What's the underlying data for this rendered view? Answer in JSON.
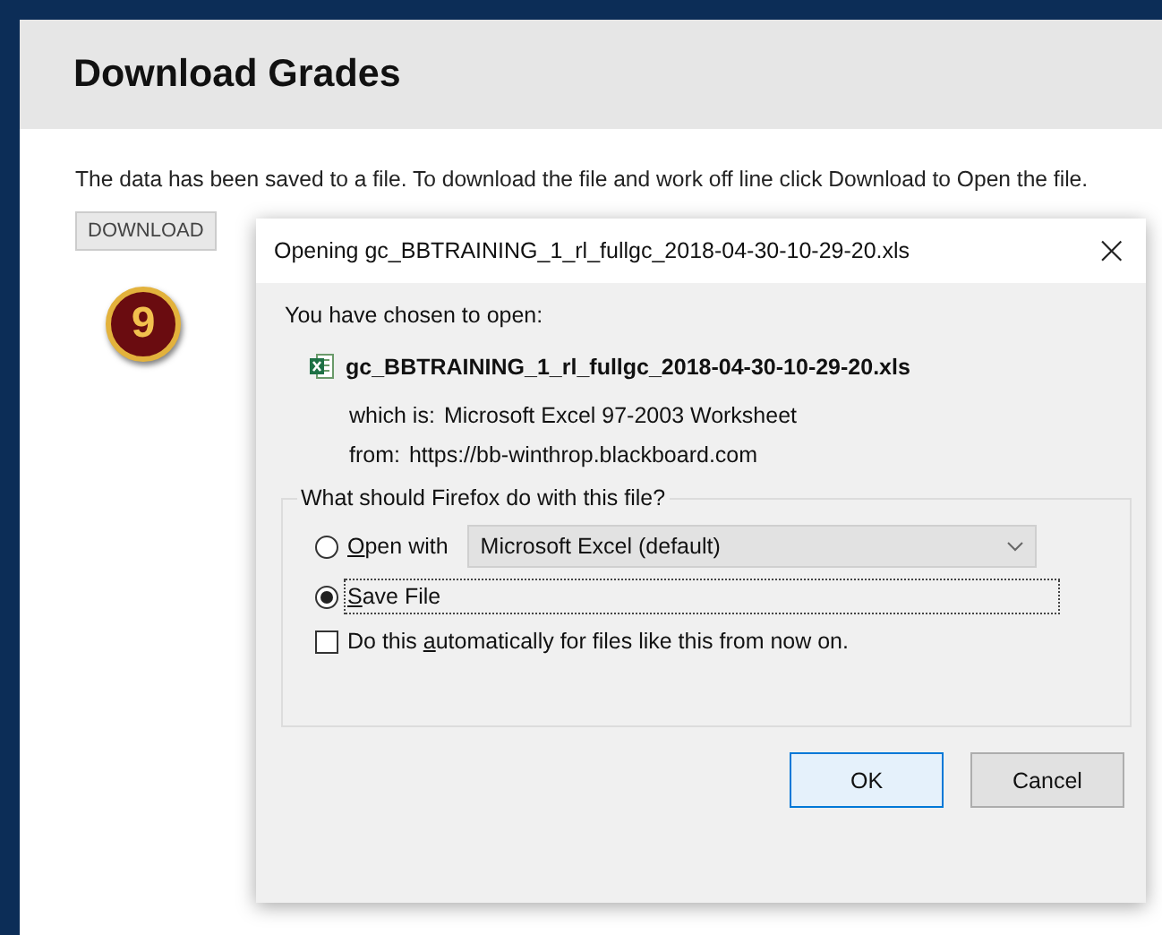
{
  "page": {
    "title": "Download Grades",
    "message": "The data has been saved to a file. To download the file and work off line click Download to Open the file.",
    "download_button": "DOWNLOAD",
    "step_badge": "9"
  },
  "dialog": {
    "title": "Opening gc_BBTRAINING_1_rl_fullgc_2018-04-30-10-29-20.xls",
    "close": "×",
    "intro": "You have chosen to open:",
    "file_name": "gc_BBTRAINING_1_rl_fullgc_2018-04-30-10-29-20.xls",
    "which_is_label": "which is:",
    "which_is_value": "Microsoft Excel 97-2003 Worksheet",
    "from_label": "from:",
    "from_value": "https://bb-winthrop.blackboard.com",
    "group_title": "What should Firefox do with this file?",
    "options": [
      {
        "kind": "open_with",
        "key": "O",
        "after": "pen with",
        "selected": false,
        "focused": false,
        "app": "Microsoft Excel (default)"
      },
      {
        "kind": "save",
        "key": "S",
        "after": "ave File",
        "selected": true,
        "focused": true
      }
    ],
    "auto": {
      "before": "Do this ",
      "key": "a",
      "after": "utomatically for files like this from now on.",
      "checked": false
    },
    "buttons": [
      {
        "label": "OK",
        "default": true
      },
      {
        "label": "Cancel",
        "default": false
      }
    ]
  }
}
